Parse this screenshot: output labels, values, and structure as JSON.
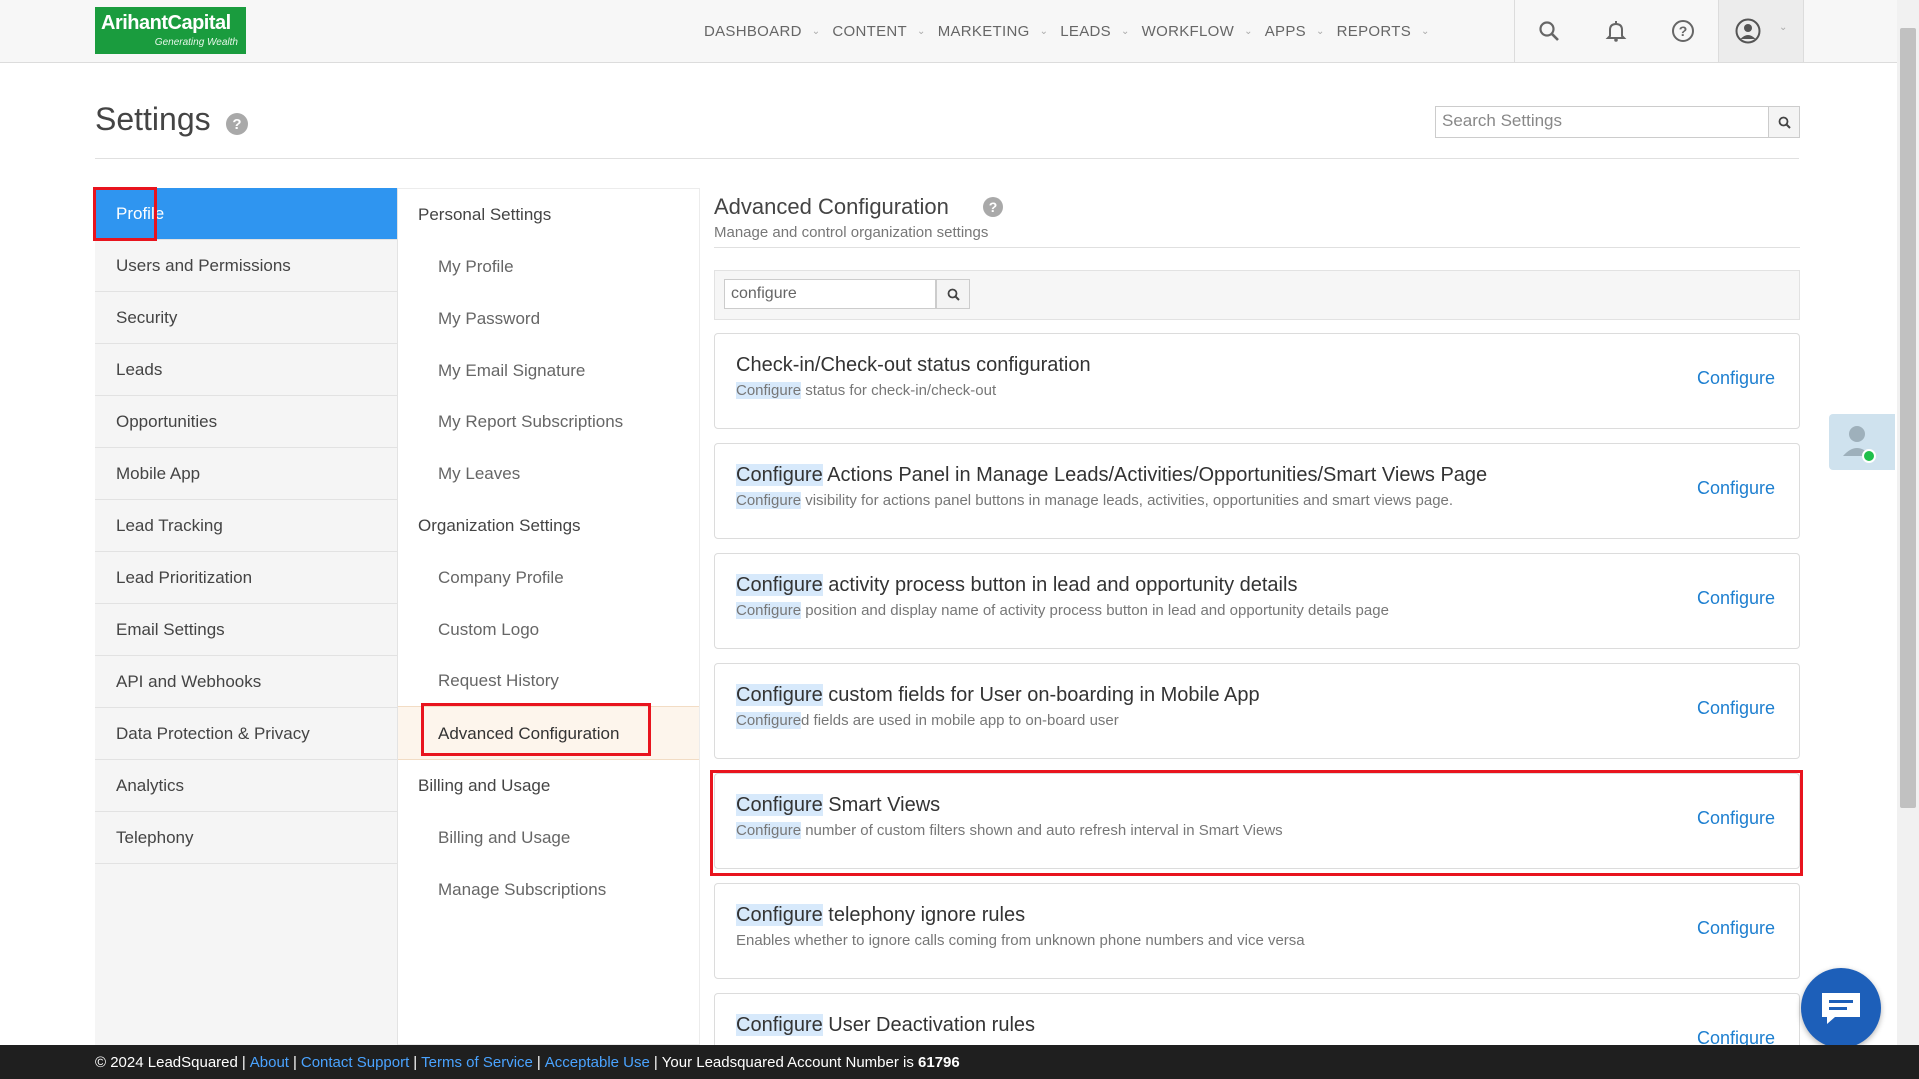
{
  "brand": {
    "name": "ArihantCapital",
    "tagline": "Generating Wealth"
  },
  "nav": [
    "DASHBOARD",
    "CONTENT",
    "MARKETING",
    "LEADS",
    "WORKFLOW",
    "APPS",
    "REPORTS"
  ],
  "page": {
    "title": "Settings",
    "help": "?",
    "search_placeholder": "Search Settings"
  },
  "left_menu": [
    "Profile",
    "Users and Permissions",
    "Security",
    "Leads",
    "Opportunities",
    "Mobile App",
    "Lead Tracking",
    "Lead Prioritization",
    "Email Settings",
    "API and Webhooks",
    "Data Protection & Privacy",
    "Analytics",
    "Telephony"
  ],
  "mid_menu": {
    "personal_heading": "Personal Settings",
    "personal": [
      "My Profile",
      "My Password",
      "My Email Signature",
      "My Report Subscriptions",
      "My Leaves"
    ],
    "org_heading": "Organization Settings",
    "org": [
      "Company Profile",
      "Custom Logo",
      "Request History",
      "Advanced Configuration"
    ],
    "billing_heading": "Billing and Usage",
    "billing": [
      "Billing and Usage",
      "Manage Subscriptions"
    ]
  },
  "content": {
    "title": "Advanced Configuration",
    "subtitle": "Manage and control organization settings",
    "filter_value": "configure",
    "link_label": "Configure",
    "cards": [
      {
        "title_hl": "",
        "title_rest": "Check-in/Check-out status configuration",
        "desc_hl": "Configure",
        "desc_rest": " status for check-in/check-out"
      },
      {
        "title_hl": "Configure",
        "title_rest": " Actions Panel in Manage Leads/Activities/Opportunities/Smart Views Page",
        "desc_hl": "Configure",
        "desc_rest": " visibility for actions panel buttons in manage leads, activities, opportunities and smart views page."
      },
      {
        "title_hl": "Configure",
        "title_rest": " activity process button in lead and opportunity details",
        "desc_hl": "Configure",
        "desc_rest": " position and display name of activity process button in lead and opportunity details page"
      },
      {
        "title_hl": "Configure",
        "title_rest": " custom fields for User on-boarding in Mobile App",
        "desc_hl": "Configure",
        "desc_rest": "d fields are used in mobile app to on-board user"
      },
      {
        "title_hl": "Configure",
        "title_rest": " Smart Views",
        "desc_hl": "Configure",
        "desc_rest": " number of custom filters shown and auto refresh interval in Smart Views"
      },
      {
        "title_hl": "Configure",
        "title_rest": " telephony ignore rules",
        "desc_hl": "",
        "desc_rest": "Enables whether to ignore calls coming from unknown phone numbers and vice versa"
      },
      {
        "title_hl": "Configure",
        "title_rest": " User Deactivation rules",
        "desc_hl": "",
        "desc_rest": ""
      }
    ]
  },
  "footer": {
    "copyright": "© 2024 LeadSquared",
    "links": [
      "About",
      "Contact Support",
      "Terms of Service",
      "Acceptable Use"
    ],
    "account_text": "Your Leadsquared Account Number is",
    "account_number": "61796"
  },
  "colors": {
    "accent": "#2f95f0",
    "link": "#1d7fd0",
    "annotation": "#e8141e",
    "brand": "#1a9c3e"
  }
}
